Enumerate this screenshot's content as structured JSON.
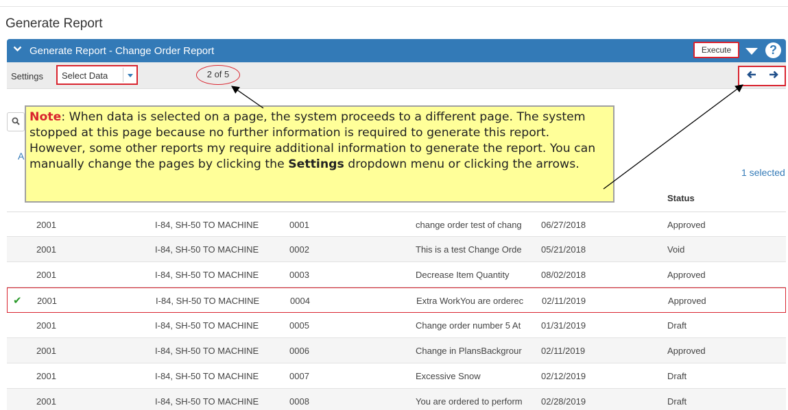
{
  "page": {
    "title": "Generate Report"
  },
  "panel": {
    "title": "Generate Report - Change Order Report",
    "execute_label": "Execute",
    "help_glyph": "?"
  },
  "settings": {
    "label": "Settings",
    "select_value": "Select Data",
    "page_indicator": "2 of 5"
  },
  "list": {
    "left_letter": "A",
    "selected_count": "1 selected",
    "status_header": "Status",
    "rows": [
      {
        "year": "2001",
        "project": "I-84, SH-50 TO MACHINE",
        "number": "0001",
        "description": "change order test of chang",
        "date": "06/27/2018",
        "status": "Approved",
        "selected": false
      },
      {
        "year": "2001",
        "project": "I-84, SH-50 TO MACHINE",
        "number": "0002",
        "description": "This is a test Change Orde",
        "date": "05/21/2018",
        "status": "Void",
        "selected": false
      },
      {
        "year": "2001",
        "project": "I-84, SH-50 TO MACHINE",
        "number": "0003",
        "description": "Decrease Item Quantity",
        "date": "08/02/2018",
        "status": "Approved",
        "selected": false
      },
      {
        "year": "2001",
        "project": "I-84, SH-50 TO MACHINE",
        "number": "0004",
        "description": "Extra WorkYou are orderec",
        "date": "02/11/2019",
        "status": "Approved",
        "selected": true
      },
      {
        "year": "2001",
        "project": "I-84, SH-50 TO MACHINE",
        "number": "0005",
        "description": "Change order number 5 At",
        "date": "01/31/2019",
        "status": "Draft",
        "selected": false
      },
      {
        "year": "2001",
        "project": "I-84, SH-50 TO MACHINE",
        "number": "0006",
        "description": "Change in PlansBackgrour",
        "date": "02/11/2019",
        "status": "Approved",
        "selected": false
      },
      {
        "year": "2001",
        "project": "I-84, SH-50 TO MACHINE",
        "number": "0007",
        "description": "Excessive Snow",
        "date": "02/12/2019",
        "status": "Draft",
        "selected": false
      },
      {
        "year": "2001",
        "project": "I-84, SH-50 TO MACHINE",
        "number": "0008",
        "description": "You are ordered to perform",
        "date": "02/28/2019",
        "status": "Draft",
        "selected": false
      }
    ]
  },
  "note": {
    "label": "Note",
    "text_1": ": When data is selected on a page, the system proceeds to a different page. The system stopped at this page because no further information is required to generate this report. However, some other reports my require additional information to generate the report. You can manually change the pages by clicking the ",
    "settings_word": "Settings",
    "text_2": " dropdown menu or clicking the arrows."
  },
  "colors": {
    "header_blue": "#337ab7",
    "highlight_red": "#d9232e",
    "note_yellow": "#ffff99",
    "check_green": "#2a9a2a"
  },
  "icons": {
    "collapse": "chevron-down-icon",
    "menu": "triangle-down-icon",
    "help": "question-circle-icon",
    "dropdown": "caret-down-icon",
    "prev": "arrow-left-icon",
    "next": "arrow-right-icon",
    "search": "search-icon",
    "selected_mark": "checkmark-icon"
  }
}
